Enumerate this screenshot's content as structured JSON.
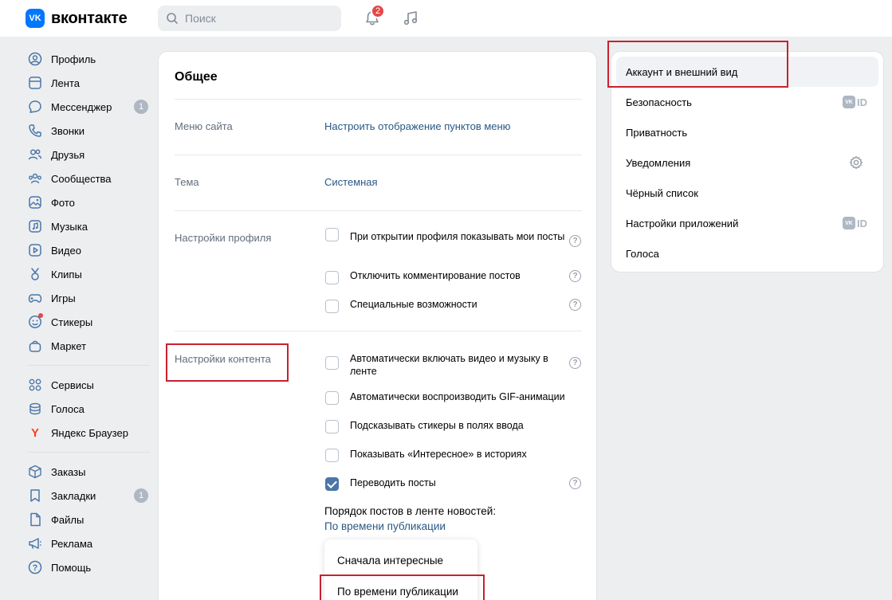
{
  "header": {
    "logo_mark": "VK",
    "logo_text": "вконтакте",
    "search_placeholder": "Поиск",
    "notifications_count": "2"
  },
  "sidebar": {
    "group1": [
      {
        "label": "Профиль",
        "icon": "user-circle-icon"
      },
      {
        "label": "Лента",
        "icon": "feed-icon"
      },
      {
        "label": "Мессенджер",
        "icon": "chat-icon",
        "count": "1"
      },
      {
        "label": "Звонки",
        "icon": "phone-icon"
      },
      {
        "label": "Друзья",
        "icon": "friends-icon"
      },
      {
        "label": "Сообщества",
        "icon": "communities-icon"
      },
      {
        "label": "Фото",
        "icon": "photo-icon"
      },
      {
        "label": "Музыка",
        "icon": "music-icon"
      },
      {
        "label": "Видео",
        "icon": "video-icon"
      },
      {
        "label": "Клипы",
        "icon": "clips-icon"
      },
      {
        "label": "Игры",
        "icon": "gamepad-icon"
      },
      {
        "label": "Стикеры",
        "icon": "sticker-icon"
      },
      {
        "label": "Маркет",
        "icon": "bag-icon"
      }
    ],
    "group2": [
      {
        "label": "Сервисы",
        "icon": "grid-icon"
      },
      {
        "label": "Голоса",
        "icon": "coins-icon"
      },
      {
        "label": "Яндекс Браузер",
        "icon": "yandex-icon"
      }
    ],
    "group3": [
      {
        "label": "Заказы",
        "icon": "box-icon"
      },
      {
        "label": "Закладки",
        "icon": "bookmark-icon",
        "count": "1"
      },
      {
        "label": "Файлы",
        "icon": "file-icon"
      },
      {
        "label": "Реклама",
        "icon": "megaphone-icon"
      },
      {
        "label": "Помощь",
        "icon": "help-icon"
      }
    ]
  },
  "main": {
    "title": "Общее",
    "menu_label": "Меню сайта",
    "menu_link": "Настроить отображение пунктов меню",
    "theme_label": "Тема",
    "theme_link": "Системная",
    "profile_label": "Настройки профиля",
    "profile_options": [
      {
        "text": "При открытии профиля показывать мои посты",
        "checked": false
      },
      {
        "text": "Отключить комментирование постов",
        "checked": false
      },
      {
        "text": "Специальные возможности",
        "checked": false
      }
    ],
    "content_label": "Настройки контента",
    "content_options": [
      {
        "text": "Автоматически включать видео и музыку в ленте",
        "checked": false
      },
      {
        "text": "Автоматически воспроизводить GIF-анимации",
        "checked": false
      },
      {
        "text": "Подсказывать стикеры в полях ввода",
        "checked": false
      },
      {
        "text": "Показывать «Интересное» в историях",
        "checked": false
      },
      {
        "text": "Переводить посты",
        "checked": true
      }
    ],
    "order_label": "Порядок постов в ленте новостей:",
    "order_value": "По времени публикации",
    "order_options": [
      "Сначала интересные",
      "По времени публикации"
    ],
    "help_glyph": "?"
  },
  "right_menu": {
    "items": [
      {
        "label": "Аккаунт и внешний вид",
        "active": true
      },
      {
        "label": "Безопасность",
        "badge": "VK ID"
      },
      {
        "label": "Приватность"
      },
      {
        "label": "Уведомления",
        "badge": "gear"
      },
      {
        "label": "Чёрный список"
      },
      {
        "label": "Настройки приложений",
        "badge": "VK ID"
      },
      {
        "label": "Голоса"
      }
    ],
    "vkid_mark": "VK",
    "vkid_text": "ID"
  },
  "colors": {
    "accent": "#0077ff",
    "link": "#2a5885",
    "highlight": "#c8212f",
    "checkbox_checked": "#4a76a8",
    "badge_red": "#e64646"
  }
}
